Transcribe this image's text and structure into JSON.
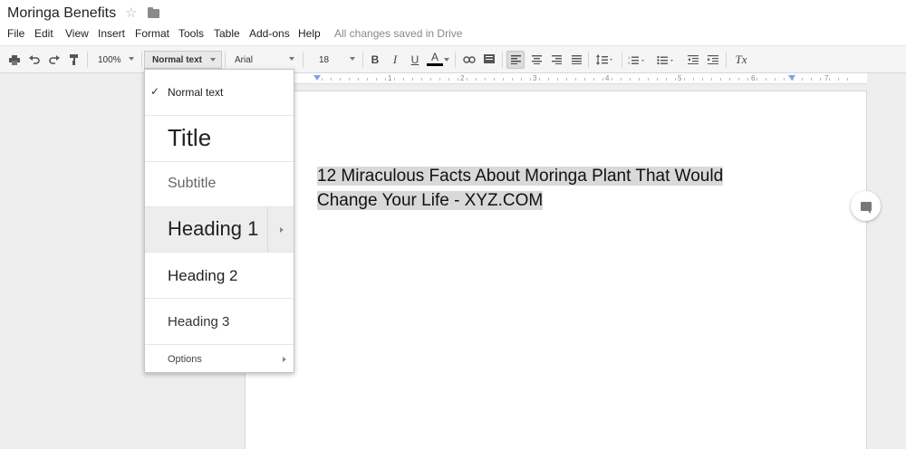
{
  "app": {
    "doc_title": "Moringa Benefits",
    "save_status": "All changes saved in Drive"
  },
  "menu": [
    "File",
    "Edit",
    "View",
    "Insert",
    "Format",
    "Tools",
    "Table",
    "Add-ons",
    "Help"
  ],
  "toolbar": {
    "zoom": "100%",
    "style": "Normal text",
    "font": "Arial",
    "size": "18",
    "bold": "B",
    "italic": "I",
    "underline": "U",
    "text_color": "A",
    "clear_format": "Tx"
  },
  "ruler": {
    "numbers": [
      "1",
      "2",
      "3",
      "4",
      "5",
      "6",
      "7"
    ]
  },
  "style_menu": {
    "items": [
      "Normal text",
      "Title",
      "Subtitle",
      "Heading 1",
      "Heading 2",
      "Heading 3",
      "Options"
    ],
    "checked": "Normal text",
    "highlighted": "Heading 1"
  },
  "document": {
    "heading_line1": "12 Miraculous Facts About Moringa Plant That Would",
    "heading_line2": "Change Your Life - XYZ.COM"
  },
  "colors": {
    "accent": "#7aa6e0",
    "selection": "#d9d9d9"
  }
}
